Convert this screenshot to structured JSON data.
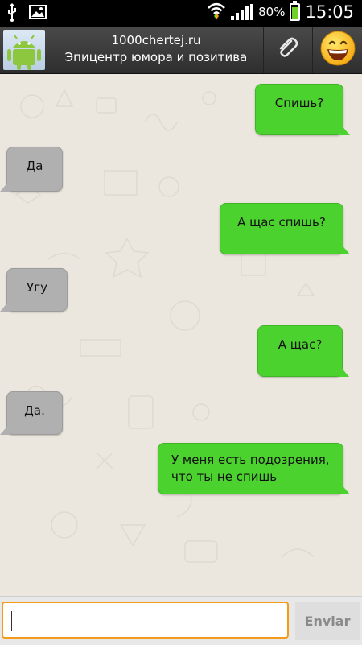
{
  "statusbar": {
    "battery_percent": "80%",
    "time": "15:05",
    "icons": [
      "usb-icon",
      "image-icon",
      "wifi-icon",
      "signal-icon",
      "battery-charging-icon"
    ]
  },
  "header": {
    "title": "1000chertej.ru",
    "subtitle": "Эпицентр юмора и позитива",
    "avatar_icon": "android-icon",
    "attach_icon": "paperclip-icon",
    "emoji_icon": "smiley-icon"
  },
  "messages": [
    {
      "direction": "out",
      "text": "Спишь?"
    },
    {
      "direction": "in",
      "text": "Да"
    },
    {
      "direction": "out",
      "text": "А щас спишь?"
    },
    {
      "direction": "in",
      "text": "Угу"
    },
    {
      "direction": "out",
      "text": "А щас?"
    },
    {
      "direction": "in",
      "text": "Да."
    },
    {
      "direction": "out",
      "text": "У меня есть подозрения,\nчто ты не спишь"
    }
  ],
  "composer": {
    "input_value": "",
    "send_label": "Enviar"
  },
  "colors": {
    "outgoing_bubble": "#4cd22f",
    "incoming_bubble": "#b0b0b0",
    "input_focus": "#f39c1c"
  }
}
